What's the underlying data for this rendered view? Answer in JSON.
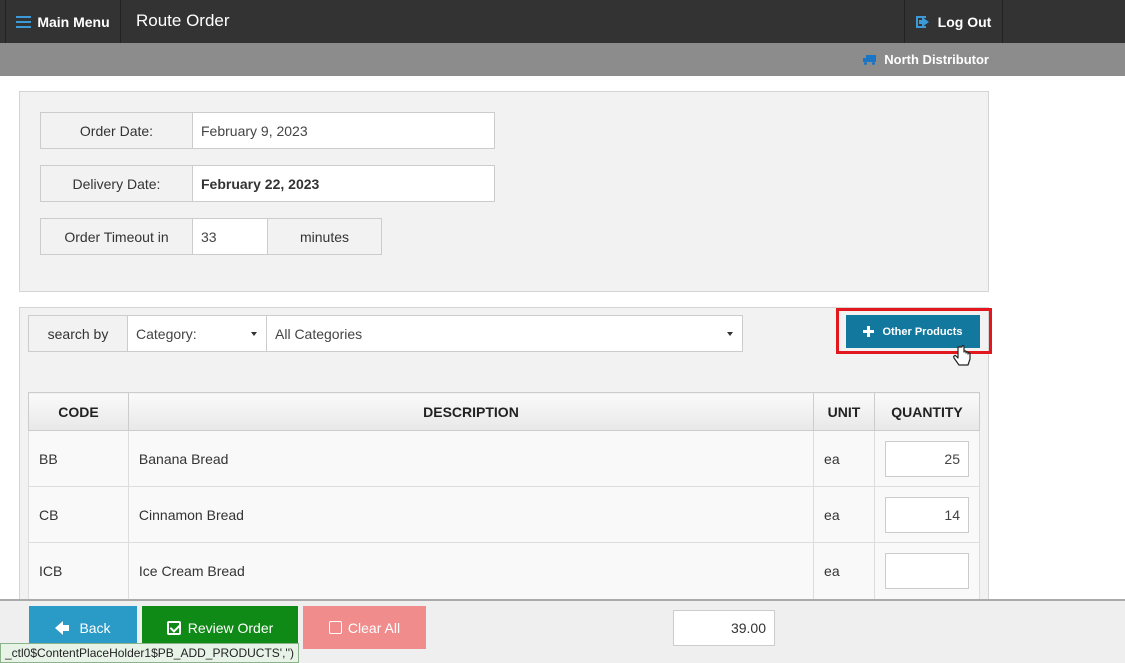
{
  "header": {
    "menu_label": "Main Menu",
    "title": "Route Order",
    "logout_label": "Log Out",
    "distributor": "North Distributor",
    "accent_color": "#3a9bd8"
  },
  "order_info": {
    "order_date_label": "Order Date:",
    "order_date_value": "February 9, 2023",
    "delivery_date_label": "Delivery Date:",
    "delivery_date_value": "February 22, 2023",
    "timeout_label": "Order Timeout in",
    "timeout_value": "33",
    "timeout_unit": "minutes"
  },
  "search": {
    "label": "search by",
    "field_selected": "Category:",
    "category_selected": "All Categories"
  },
  "other_products_label": "Other Products",
  "table": {
    "headers": [
      "CODE",
      "DESCRIPTION",
      "UNIT",
      "QUANTITY"
    ],
    "rows": [
      {
        "code": "BB",
        "description": "Banana Bread",
        "unit": "ea",
        "quantity": "25"
      },
      {
        "code": "CB",
        "description": "Cinnamon Bread",
        "unit": "ea",
        "quantity": "14"
      },
      {
        "code": "ICB",
        "description": "Ice Cream Bread",
        "unit": "ea",
        "quantity": ""
      }
    ]
  },
  "footer": {
    "back_label": "Back",
    "review_label": "Review Order",
    "clear_label": "Clear All",
    "total": "39.00"
  },
  "status_tip": "_ctl0$ContentPlaceHolder1$PB_ADD_PRODUCTS','')"
}
